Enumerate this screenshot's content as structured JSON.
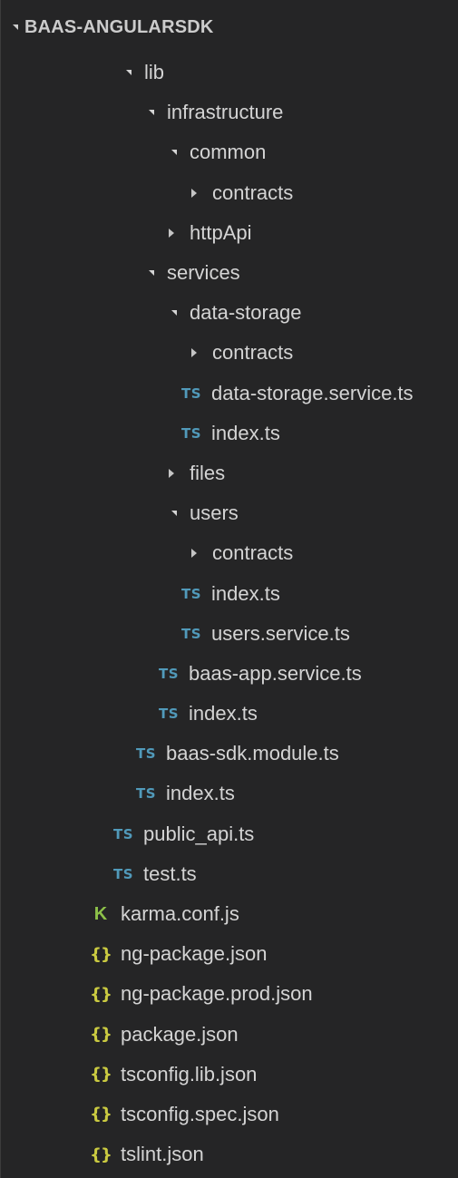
{
  "header": {
    "title": "BAAS-ANGULARSDK",
    "expanded": true
  },
  "colors": {
    "background": "#252526",
    "text": "#d4d4d4",
    "ts_icon": "#519aba",
    "json_icon": "#cbcb41",
    "karma_icon": "#8dc149"
  },
  "tree": [
    {
      "label": "lib",
      "type": "folder",
      "expanded": true,
      "depth": 5
    },
    {
      "label": "infrastructure",
      "type": "folder",
      "expanded": true,
      "depth": 6
    },
    {
      "label": "common",
      "type": "folder",
      "expanded": true,
      "depth": 7
    },
    {
      "label": "contracts",
      "type": "folder",
      "expanded": false,
      "depth": 8
    },
    {
      "label": "httpApi",
      "type": "folder",
      "expanded": false,
      "depth": 7
    },
    {
      "label": "services",
      "type": "folder",
      "expanded": true,
      "depth": 6
    },
    {
      "label": "data-storage",
      "type": "folder",
      "expanded": true,
      "depth": 7
    },
    {
      "label": "contracts",
      "type": "folder",
      "expanded": false,
      "depth": 8
    },
    {
      "label": "data-storage.service.ts",
      "type": "file",
      "icon": "TS",
      "icon_name": "typescript-icon",
      "depth": 8
    },
    {
      "label": "index.ts",
      "type": "file",
      "icon": "TS",
      "icon_name": "typescript-icon",
      "depth": 8
    },
    {
      "label": "files",
      "type": "folder",
      "expanded": false,
      "depth": 7
    },
    {
      "label": "users",
      "type": "folder",
      "expanded": true,
      "depth": 7
    },
    {
      "label": "contracts",
      "type": "folder",
      "expanded": false,
      "depth": 8
    },
    {
      "label": "index.ts",
      "type": "file",
      "icon": "TS",
      "icon_name": "typescript-icon",
      "depth": 8
    },
    {
      "label": "users.service.ts",
      "type": "file",
      "icon": "TS",
      "icon_name": "typescript-icon",
      "depth": 8
    },
    {
      "label": "baas-app.service.ts",
      "type": "file",
      "icon": "TS",
      "icon_name": "typescript-icon",
      "depth": 7
    },
    {
      "label": "index.ts",
      "type": "file",
      "icon": "TS",
      "icon_name": "typescript-icon",
      "depth": 7
    },
    {
      "label": "baas-sdk.module.ts",
      "type": "file",
      "icon": "TS",
      "icon_name": "typescript-icon",
      "depth": 6
    },
    {
      "label": "index.ts",
      "type": "file",
      "icon": "TS",
      "icon_name": "typescript-icon",
      "depth": 6
    },
    {
      "label": "public_api.ts",
      "type": "file",
      "icon": "TS",
      "icon_name": "typescript-icon",
      "depth": 5
    },
    {
      "label": "test.ts",
      "type": "file",
      "icon": "TS",
      "icon_name": "typescript-icon",
      "depth": 5
    },
    {
      "label": "karma.conf.js",
      "type": "file",
      "icon": "K",
      "icon_name": "karma-icon",
      "depth": 4
    },
    {
      "label": "ng-package.json",
      "type": "file",
      "icon": "{}",
      "icon_name": "json-icon",
      "depth": 4
    },
    {
      "label": "ng-package.prod.json",
      "type": "file",
      "icon": "{}",
      "icon_name": "json-icon",
      "depth": 4
    },
    {
      "label": "package.json",
      "type": "file",
      "icon": "{}",
      "icon_name": "json-icon",
      "depth": 4
    },
    {
      "label": "tsconfig.lib.json",
      "type": "file",
      "icon": "{}",
      "icon_name": "json-icon",
      "depth": 4
    },
    {
      "label": "tsconfig.spec.json",
      "type": "file",
      "icon": "{}",
      "icon_name": "json-icon",
      "depth": 4
    },
    {
      "label": "tslint.json",
      "type": "file",
      "icon": "{}",
      "icon_name": "json-icon",
      "depth": 4
    }
  ]
}
